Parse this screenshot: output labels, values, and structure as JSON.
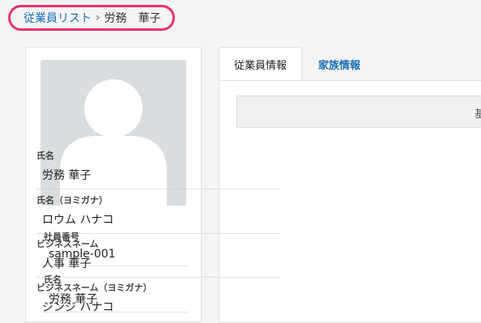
{
  "breadcrumb": {
    "parent": "従業員リスト",
    "separator": "›",
    "current": "労務　華子"
  },
  "profile": {
    "avatar_icon": "person-silhouette-icon",
    "fields": [
      {
        "label": "社員番号",
        "value": "sample-001"
      },
      {
        "label": "氏名",
        "value": "労務 華子"
      }
    ]
  },
  "tabs": [
    {
      "label": "従業員情報",
      "active": true
    },
    {
      "label": "家族情報",
      "active": false
    }
  ],
  "section": {
    "header": "基"
  },
  "details": [
    {
      "label": "氏名",
      "value": "労務 華子"
    },
    {
      "label": "氏名（ヨミガナ）",
      "value": "ロウム ハナコ"
    },
    {
      "label": "ビジネスネーム",
      "value": "人事 華子"
    },
    {
      "label": "ビジネスネーム（ヨミガナ）",
      "value": "ジンジ ハナコ"
    }
  ],
  "colors": {
    "accent": "#e8336e",
    "link": "#1a6fb5",
    "background": "#f4f4f4",
    "avatar_bg": "#d9dddf"
  }
}
